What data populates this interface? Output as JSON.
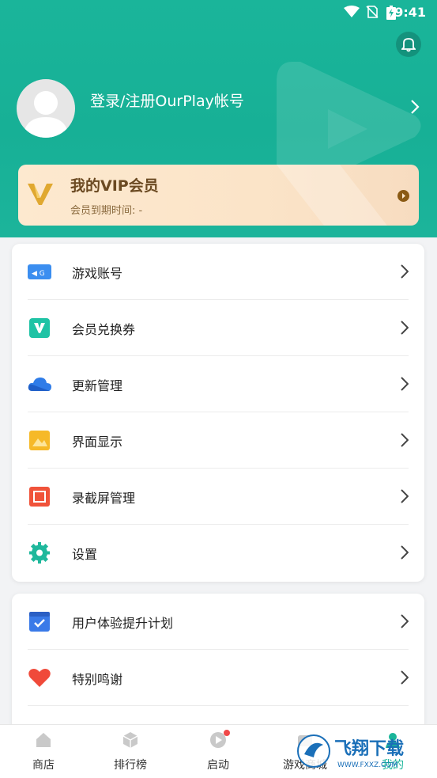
{
  "status_bar": {
    "time": "9:41"
  },
  "profile": {
    "login_text": "登录/注册OurPlay帐号"
  },
  "vip": {
    "title": "我的VIP会员",
    "expiry": "会员到期时间: -"
  },
  "menu1": [
    {
      "label": "游戏账号",
      "icon": "game-account-icon"
    },
    {
      "label": "会员兑换券",
      "icon": "vip-coupon-icon"
    },
    {
      "label": "更新管理",
      "icon": "cloud-update-icon"
    },
    {
      "label": "界面显示",
      "icon": "display-icon"
    },
    {
      "label": "录截屏管理",
      "icon": "screen-record-icon"
    },
    {
      "label": "设置",
      "icon": "settings-gear-icon"
    }
  ],
  "menu2": [
    {
      "label": "用户体验提升计划",
      "icon": "ux-plan-icon"
    },
    {
      "label": "特别鸣谢",
      "icon": "heart-icon"
    }
  ],
  "tabs": [
    {
      "label": "商店",
      "icon": "store-icon"
    },
    {
      "label": "排行榜",
      "icon": "ranking-icon"
    },
    {
      "label": "启动",
      "icon": "launch-icon"
    },
    {
      "label": "游戏商城",
      "icon": "game-mall-icon"
    },
    {
      "label": "我的",
      "icon": "me-icon"
    }
  ],
  "watermark": {
    "text": "飞翔下载",
    "url": "WWW.FXXZ.COM"
  },
  "colors": {
    "brand": "#1ab59a",
    "vip_text": "#6b4a22"
  }
}
